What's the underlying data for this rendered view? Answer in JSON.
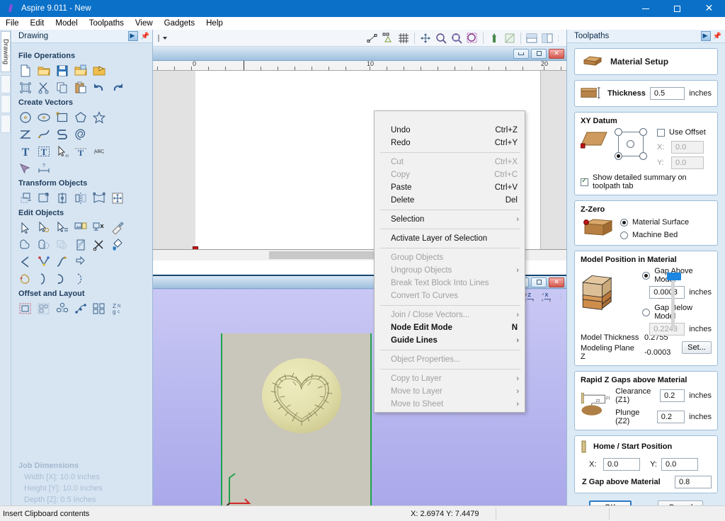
{
  "window": {
    "title": "Aspire 9.011 - New",
    "app_icon": "aspire-logo-icon",
    "minimize": "minimize-icon",
    "maximize": "maximize-icon",
    "close": "close-icon"
  },
  "menubar": {
    "items": [
      "File",
      "Edit",
      "Model",
      "Toolpaths",
      "View",
      "Gadgets",
      "Help"
    ]
  },
  "left_panel": {
    "vertical_tab": "Drawing",
    "header_title": "Drawing",
    "groups": [
      {
        "title": "File Operations",
        "rows": [
          [
            "new-file-icon",
            "open-folder-icon",
            "save-icon",
            "import-folder-icon",
            "export-icon"
          ],
          [
            "job-setup-icon",
            "cut-scissors-icon",
            "copy-icon",
            "paste-icon",
            "undo-icon",
            "redo-icon"
          ]
        ]
      },
      {
        "title": "Create Vectors",
        "rows": [
          [
            "circle-icon",
            "ellipse-icon",
            "rectangle-icon",
            "polygon-icon",
            "star-icon"
          ],
          [
            "polyline-icon",
            "curve-icon",
            "draw-curve-icon",
            "spiral-icon"
          ],
          [
            "text-icon",
            "text-box-icon",
            "text-select-icon",
            "text-on-curve-icon",
            "arc-text-icon"
          ],
          [
            "trace-bitmap-icon",
            "dimension-icon"
          ]
        ]
      },
      {
        "title": "Transform Objects",
        "rows": [
          [
            "move-icon",
            "scale-icon",
            "rotate-icon",
            "mirror-icon",
            "distort-icon",
            "align-icon"
          ]
        ]
      },
      {
        "title": "Edit Objects",
        "rows": [
          [
            "select-arrow-icon",
            "select-add-icon",
            "select-multi-icon",
            "bitmap-props-icon",
            "delete-object-icon",
            "measure-icon"
          ],
          [
            "weld-icon",
            "subtract-icon",
            "intersect-icon",
            "fill-icon",
            "trim-icon",
            "paint-icon"
          ],
          [
            "fillet-icon",
            "node-edit-icon",
            "smooth-icon",
            "offset-icon"
          ],
          [
            "close-vector-icon",
            "join-icon",
            "curve-fit-icon",
            "nodes-icon"
          ]
        ]
      },
      {
        "title": "Offset and Layout",
        "rows": [
          [
            "offset-vectors-icon",
            "nesting-icon",
            "array-copy-icon",
            "copy-along-curve-icon",
            "block-copy-icon",
            "text-layout-icon"
          ]
        ]
      }
    ],
    "job_dimensions": {
      "title": "Job Dimensions",
      "width": "Width  [X]: 10.0 inches",
      "height": "Height [Y]: 10.0 inches",
      "depth": "Depth  [Z]: 0.5 inches"
    }
  },
  "center": {
    "toolbar_left_icons": [
      "layer-dropdown-icon"
    ],
    "toolbar_icons": [
      "snap-node-icon",
      "snap-geometry-icon",
      "grid-snap-icon",
      "pan-icon",
      "zoom-icon",
      "zoom-window-icon",
      "zoom-selected-icon",
      "zoom-extents-icon",
      "shade-view-icon",
      "two-view-icon",
      "split-view-icon"
    ],
    "view_2d": {
      "caption_buttons": [
        "minimize-icon",
        "maximize-icon",
        "close-icon"
      ],
      "ruler_labels": [
        "0",
        "10",
        "20"
      ]
    },
    "view_3d": {
      "caption_buttons": [
        "minimize-icon",
        "maximize-icon",
        "close-icon"
      ],
      "axis_icons": [
        "zoom-extents-3d-icon",
        "iso-view-icon",
        "z-x-view-icon",
        "x-y-view-icon"
      ],
      "model_name": "heart-wreath-model"
    }
  },
  "context_menu": {
    "items": [
      {
        "label": "Undo",
        "shortcut": "Ctrl+Z",
        "disabled": false,
        "bold": false,
        "submenu": false
      },
      {
        "label": "Redo",
        "shortcut": "Ctrl+Y",
        "disabled": false,
        "bold": false,
        "submenu": false
      },
      {
        "separator": true
      },
      {
        "label": "Cut",
        "shortcut": "Ctrl+X",
        "disabled": true,
        "bold": false,
        "submenu": false
      },
      {
        "label": "Copy",
        "shortcut": "Ctrl+C",
        "disabled": true,
        "bold": false,
        "submenu": false
      },
      {
        "label": "Paste",
        "shortcut": "Ctrl+V",
        "disabled": false,
        "bold": false,
        "submenu": false
      },
      {
        "label": "Delete",
        "shortcut": "Del",
        "disabled": false,
        "bold": false,
        "submenu": false
      },
      {
        "separator": true
      },
      {
        "label": "Selection",
        "shortcut": "",
        "disabled": false,
        "bold": false,
        "submenu": true
      },
      {
        "separator": true
      },
      {
        "label": "Activate Layer of Selection",
        "shortcut": "",
        "disabled": false,
        "bold": false,
        "submenu": false
      },
      {
        "separator": true
      },
      {
        "label": "Group Objects",
        "shortcut": "",
        "disabled": true,
        "bold": false,
        "submenu": false
      },
      {
        "label": "Ungroup Objects",
        "shortcut": "",
        "disabled": true,
        "bold": false,
        "submenu": true
      },
      {
        "label": "Break Text Block Into Lines",
        "shortcut": "",
        "disabled": true,
        "bold": false,
        "submenu": false
      },
      {
        "label": "Convert To Curves",
        "shortcut": "",
        "disabled": true,
        "bold": false,
        "submenu": false
      },
      {
        "separator": true
      },
      {
        "label": "Join / Close Vectors...",
        "shortcut": "",
        "disabled": true,
        "bold": false,
        "submenu": true
      },
      {
        "label": "Node Edit Mode",
        "shortcut": "N",
        "disabled": false,
        "bold": true,
        "submenu": false
      },
      {
        "label": "Guide Lines",
        "shortcut": "",
        "disabled": false,
        "bold": true,
        "submenu": true
      },
      {
        "separator": true
      },
      {
        "label": "Object Properties...",
        "shortcut": "",
        "disabled": true,
        "bold": false,
        "submenu": false
      },
      {
        "separator": true
      },
      {
        "label": "Copy to Layer",
        "shortcut": "",
        "disabled": true,
        "bold": false,
        "submenu": true
      },
      {
        "label": "Move to Layer",
        "shortcut": "",
        "disabled": true,
        "bold": false,
        "submenu": true
      },
      {
        "label": "Move to Sheet",
        "shortcut": "",
        "disabled": true,
        "bold": false,
        "submenu": true
      }
    ]
  },
  "right_panel": {
    "header_title": "Toolpaths",
    "header_icons": [
      "float-panel-icon",
      "pin-icon"
    ],
    "material_setup": {
      "title": "Material Setup",
      "icon": "material-block-icon"
    },
    "thickness": {
      "label": "Thickness",
      "value": "0.5",
      "unit": "inches",
      "icon": "thickness-icon"
    },
    "xy_datum": {
      "title": "XY Datum",
      "icon": "datum-plane-icon",
      "use_offset_label": "Use Offset",
      "use_offset_checked": false,
      "x_label": "X:",
      "x_value": "0.0",
      "y_label": "Y:",
      "y_value": "0.0",
      "selected_corner": "bottom-left",
      "summary_label": "Show detailed summary on toolpath tab",
      "summary_checked": true
    },
    "z_zero": {
      "title": "Z-Zero",
      "icon": "z-zero-block-icon",
      "options": [
        "Material Surface",
        "Machine Bed"
      ],
      "selected": "Material Surface"
    },
    "model_position": {
      "title": "Model Position in Material",
      "icon": "model-block-icon",
      "gap_above_label": "Gap Above Model",
      "gap_above_value": "0.0003",
      "gap_above_unit": "inches",
      "gap_above_selected": true,
      "gap_below_label": "Gap Below Model",
      "gap_below_value": "0.2243",
      "gap_below_unit": "inches",
      "gap_below_selected": false,
      "model_thickness_label": "Model Thickness",
      "model_thickness_value": "0.2755",
      "modeling_plane_label": "Modeling Plane Z",
      "modeling_plane_value": "-0.0003",
      "set_button": "Set..."
    },
    "rapid_z": {
      "title": "Rapid Z Gaps above Material",
      "icon": "rapid-z-icon",
      "clearance_label": "Clearance (Z1)",
      "clearance_prefix": "Z1",
      "clearance_value": "0.2",
      "clearance_unit": "inches",
      "plunge_label": "Plunge (Z2)",
      "plunge_prefix": "Z2",
      "plunge_value": "0.2",
      "plunge_unit": "inches"
    },
    "home_start": {
      "title": "Home / Start Position",
      "icon": "home-position-icon",
      "x_label": "X:",
      "x_value": "0.0",
      "y_label": "Y:",
      "y_value": "0.0",
      "z_gap_label": "Z Gap above Material",
      "z_gap_value": "0.8"
    },
    "buttons": {
      "ok": "OK",
      "cancel": "Cancel"
    }
  },
  "statusbar": {
    "message": "Insert Clipboard contents",
    "coordinates": "X: 2.6974 Y: 7.4479"
  },
  "colors": {
    "titlebar": "#0a70c8",
    "panel_bg": "#d7e5f3",
    "right_panel_bg": "#dceaf6",
    "view3d_bg": "#b9b8f0",
    "accent_blue": "#1c86e0",
    "origin_red": "#c01414",
    "model_green": "#1fa34b",
    "wood": "#c08b5c"
  }
}
